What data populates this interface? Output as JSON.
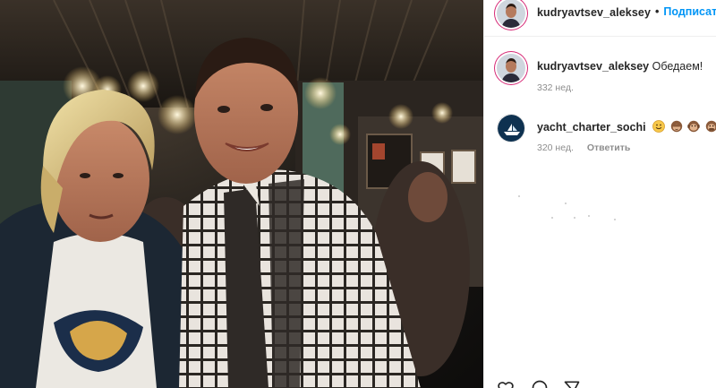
{
  "post": {
    "username": "kudryavtsev_aleksey",
    "separator": "•",
    "follow_label": "Подписаться"
  },
  "comments": [
    {
      "username": "kudryavtsev_aleksey",
      "text": "Обедаем!",
      "age": "332 нед."
    },
    {
      "username": "yacht_charter_sochi",
      "emojis": [
        "grinning-face",
        "see-no-evil-monkey",
        "hear-no-evil-monkey",
        "speak-no-evil-monkey"
      ],
      "age": "320 нед.",
      "reply_label": "Ответить"
    }
  ],
  "colors": {
    "link": "#0095f6",
    "muted": "#8e8e8e",
    "text": "#262626",
    "story_ring": "#d62976"
  },
  "actions": [
    "heart-icon",
    "comment-icon",
    "share-icon"
  ]
}
